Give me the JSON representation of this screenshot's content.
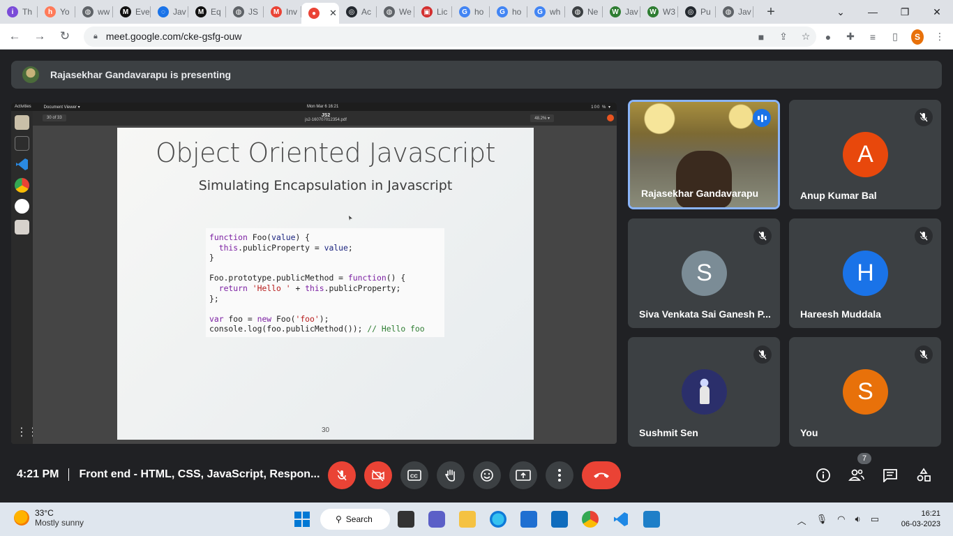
{
  "browser": {
    "tabs": [
      {
        "label": "Th",
        "color": "#7b4bd8",
        "glyph": "i"
      },
      {
        "label": "Yo",
        "color": "#ff7a59",
        "glyph": "h"
      },
      {
        "label": "ww",
        "color": "#5f6368",
        "glyph": "◍"
      },
      {
        "label": "Eve",
        "color": "#111111",
        "glyph": "M"
      },
      {
        "label": "Jav",
        "color": "#1a73e8",
        "glyph": "◌"
      },
      {
        "label": "Eq",
        "color": "#111111",
        "glyph": "M"
      },
      {
        "label": "JS",
        "color": "#5f6368",
        "glyph": "◍"
      },
      {
        "label": "Inv",
        "color": "#ea4335",
        "glyph": "M"
      },
      {
        "label": "",
        "color": "#ea4335",
        "glyph": "●",
        "active": true
      },
      {
        "label": "Ac",
        "color": "#24292f",
        "glyph": "◎"
      },
      {
        "label": "We",
        "color": "#5f6368",
        "glyph": "◍"
      },
      {
        "label": "Lic",
        "color": "#d32f2f",
        "glyph": "▣"
      },
      {
        "label": "ho",
        "color": "#4285f4",
        "glyph": "G"
      },
      {
        "label": "ho",
        "color": "#4285f4",
        "glyph": "G"
      },
      {
        "label": "wh",
        "color": "#4285f4",
        "glyph": "G"
      },
      {
        "label": "Ne",
        "color": "#3c4043",
        "glyph": "◍"
      },
      {
        "label": "Jav",
        "color": "#2e7d32",
        "glyph": "W"
      },
      {
        "label": "W3",
        "color": "#2e7d32",
        "glyph": "W"
      },
      {
        "label": "Pu",
        "color": "#24292f",
        "glyph": "◎"
      },
      {
        "label": "Jav",
        "color": "#5f6368",
        "glyph": "◍"
      }
    ],
    "url": "meet.google.com/cke-gsfg-ouw",
    "profile_initial": "S"
  },
  "meet": {
    "presenting_text": "Rajasekhar Gandavarapu is presenting",
    "shared_screen": {
      "activities": "Activities",
      "app_menu": "Document Viewer ▾",
      "clock": "Mon Mar 6  16:21",
      "battery": "100 % ▾",
      "page_field": "30",
      "page_of": "of 33",
      "doc_title": "JS2",
      "doc_file": "js2-160707012354.pdf",
      "zoom": "48.2% ▾",
      "slide": {
        "title": "Object Oriented Javascript",
        "subtitle": "Simulating Encapsulation in Javascript",
        "page_number": "30"
      }
    },
    "participants": [
      {
        "name": "Rajasekhar Gandavarapu",
        "type": "video"
      },
      {
        "name": "Anup Kumar Bal",
        "initial": "A",
        "color": "#e8480c"
      },
      {
        "name": "Siva Venkata Sai Ganesh P...",
        "initial": "S",
        "color": "#7b8c96"
      },
      {
        "name": "Hareesh Muddala",
        "initial": "H",
        "color": "#1a73e8"
      },
      {
        "name": "Sushmit Sen",
        "type": "image"
      },
      {
        "name": "You",
        "initial": "S",
        "color": "#e8710a"
      }
    ],
    "bottom": {
      "time": "4:21 PM",
      "meeting_title": "Front end - HTML, CSS, JavaScript, Respon...",
      "people_count": "7"
    }
  },
  "taskbar": {
    "temperature": "33°C",
    "weather": "Mostly sunny",
    "search_label": "Search",
    "time": "16:21",
    "date": "06-03-2023"
  }
}
